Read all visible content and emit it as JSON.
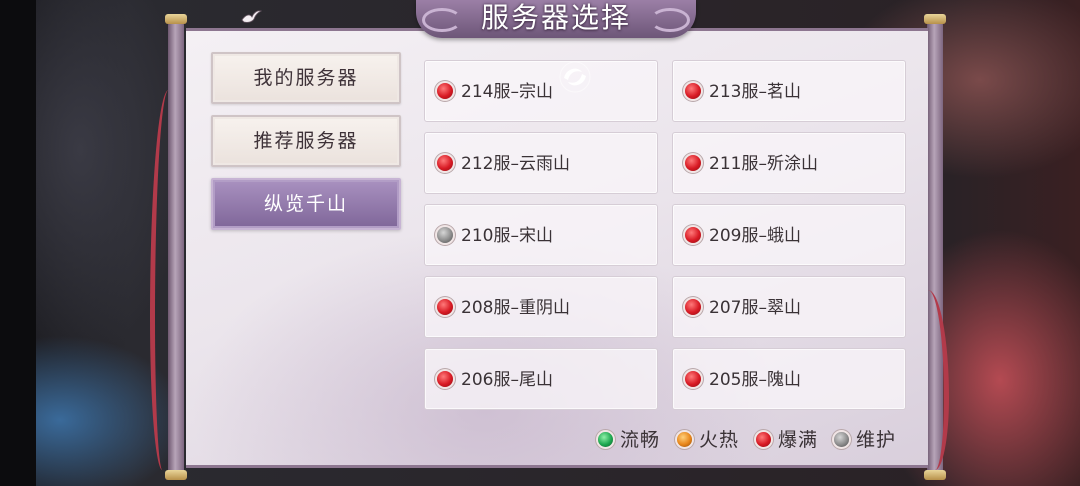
{
  "title": "服务器选择",
  "tabs": [
    {
      "label": "我的服务器",
      "active": false
    },
    {
      "label": "推荐服务器",
      "active": false
    },
    {
      "label": "纵览千山",
      "active": true
    }
  ],
  "servers": [
    {
      "name": "214服–宗山",
      "status": "red"
    },
    {
      "name": "213服–茗山",
      "status": "red"
    },
    {
      "name": "212服–云雨山",
      "status": "red"
    },
    {
      "name": "211服–歽涂山",
      "status": "red"
    },
    {
      "name": "210服–宋山",
      "status": "gray"
    },
    {
      "name": "209服–蛾山",
      "status": "red"
    },
    {
      "name": "208服–重阴山",
      "status": "red"
    },
    {
      "name": "207服–翠山",
      "status": "red"
    },
    {
      "name": "206服–尾山",
      "status": "red"
    },
    {
      "name": "205服–隗山",
      "status": "red"
    }
  ],
  "legend": [
    {
      "label": "流畅",
      "color": "green"
    },
    {
      "label": "火热",
      "color": "orange"
    },
    {
      "label": "爆满",
      "color": "red"
    },
    {
      "label": "维护",
      "color": "gray"
    }
  ],
  "icons": {
    "title_bird": "swallow-icon",
    "loading": "swirl-icon"
  },
  "colors": {
    "accent_purple": "#8a70a5",
    "status_red": "#d81a24",
    "status_gray": "#8d8d8d",
    "status_green": "#1ea850",
    "status_orange": "#e8861a"
  }
}
